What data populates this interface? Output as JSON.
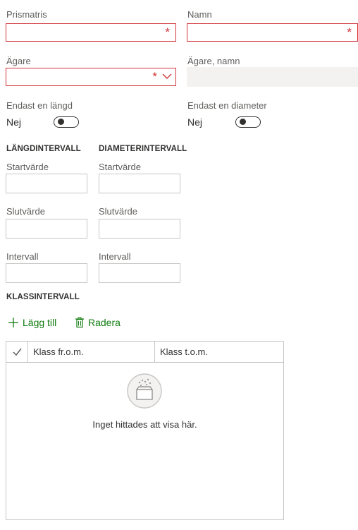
{
  "form": {
    "prismatris": {
      "label": "Prismatris",
      "value": "",
      "required_mark": "*"
    },
    "namn": {
      "label": "Namn",
      "value": "",
      "required_mark": "*"
    },
    "agare": {
      "label": "Ägare",
      "value": "",
      "required_mark": "*"
    },
    "agare_namn": {
      "label": "Ägare, namn",
      "value": ""
    },
    "endast_langd": {
      "label": "Endast en längd",
      "value": "Nej",
      "on": false
    },
    "endast_diameter": {
      "label": "Endast en diameter",
      "value": "Nej",
      "on": false
    }
  },
  "langdintervall": {
    "title": "LÄNGDINTERVALL",
    "startvarde": "Startvärde",
    "slutvarde": "Slutvärde",
    "intervall": "Intervall"
  },
  "diameterintervall": {
    "title": "DIAMETERINTERVALL",
    "startvarde": "Startvärde",
    "slutvarde": "Slutvärde",
    "intervall": "Intervall"
  },
  "klassintervall": {
    "title": "KLASSINTERVALL",
    "add_label": "Lägg till",
    "delete_label": "Radera",
    "columns": [
      "Klass fr.o.m.",
      "Klass t.o.m."
    ],
    "empty_message": "Inget hittades att visa här."
  },
  "colors": {
    "required": "#d13438",
    "action": "#107c10",
    "border": "#c8c6c4"
  },
  "icons": {
    "add": "plus-icon",
    "delete": "trash-icon",
    "dropdown": "chevron-down-icon",
    "select_all": "checkmark-icon",
    "empty": "empty-folder-icon"
  }
}
